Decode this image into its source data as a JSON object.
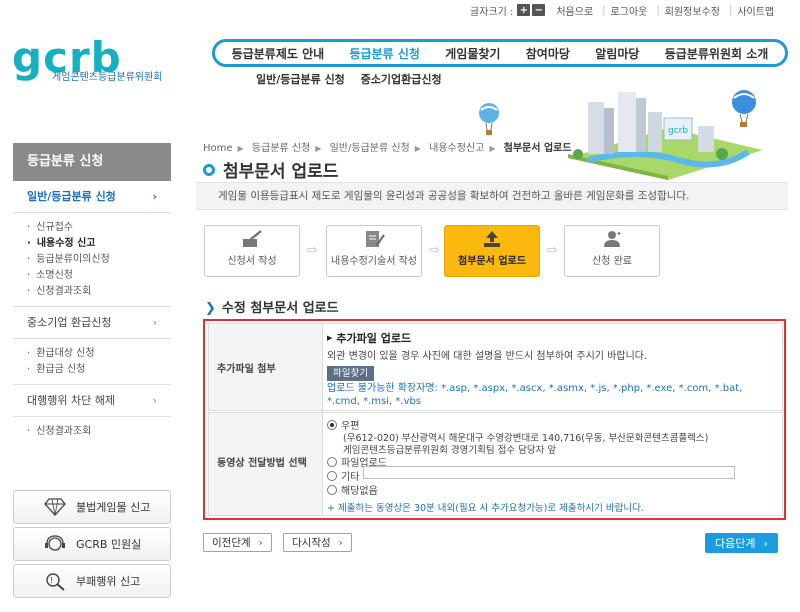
{
  "util": {
    "font_size_label": "글자크기 :",
    "plus": "+",
    "minus": "−",
    "links": [
      "처음으로",
      "로그아웃",
      "회원정보수정",
      "사이트맵"
    ]
  },
  "logo": {
    "word": "gcrb",
    "sub": "게임콘텐츠등급분류위원회"
  },
  "gnb": [
    "등급분류제도 안내",
    "등급분류 신청",
    "게임물찾기",
    "참여마당",
    "알림마당",
    "등급분류위원회 소개"
  ],
  "subnav": [
    "일반/등급분류 신청",
    "중소기업환급신청"
  ],
  "lmenu": {
    "title": "등급분류 신청",
    "groups": [
      {
        "label": "일반/등급분류 신청",
        "items": [
          "신규접수",
          "내용수정 신고",
          "등급분류이의신청",
          "소명신청",
          "신청결과조회"
        ]
      },
      {
        "label": "중소기업 환급신청",
        "items": [
          "환급대상 신청",
          "환급금 신청"
        ]
      },
      {
        "label": "대행행위 차단 해제",
        "items": [
          "신청결과조회"
        ]
      }
    ],
    "arrow": "›"
  },
  "banners": [
    "불법게임물 신고",
    "GCRB 민원실",
    "부패행위 신고"
  ],
  "breadcrumb": [
    "Home",
    "등급분류 신청",
    "일반/등급분류 신청",
    "내용수정신고",
    "첨부문서 업로드"
  ],
  "page_title": "첨부문서 업로드",
  "intro": "게임물 이용등급표시 제도로 게임물의 윤리성과 공공성을 확보하여 건전하고 올바른 게임문화를 조성합니다.",
  "steps": [
    "신청서 작성",
    "내용수정기술서 작성",
    "첨부문서 업로드",
    "신청 완료"
  ],
  "section_title": "수정 첨부문서 업로드",
  "form": {
    "attach_label": "추가파일 첨부",
    "attach_heading": "추가파일 업로드",
    "attach_desc": "외관 변경이 있을 경우 사진에 대한 설명을 반드시 첨부하여 주시기 바랍니다.",
    "file_button": "파일찾기",
    "blocked_ext": "업로드 불가능한 확장자명: *.asp, *.aspx, *.ascx, *.asmx, *.js, *.php, *.exe, *.com, *.bat, *.cmd, *.msi, *.vbs",
    "video_label": "동영상 전달방법 선택",
    "options": [
      "우편",
      "파일업로드",
      "기타",
      "해당없음"
    ],
    "address1": "(우612-020) 부산광역시 해운대구 수영강변대로 140,716(우동, 부산문화콘텐츠콤플렉스)",
    "address2": "게임콘텐츠등급분류위원회 경영기획팀 접수 담당자 앞",
    "etc_value": "",
    "note": "+ 제출하는 동영상은 30분 내외(필요 시 추가요청가능)로 제출하시기 바랍니다."
  },
  "buttons": {
    "prev": "이전단계",
    "rewrite": "다시작성",
    "next": "다음단계",
    "arrow": "›"
  }
}
